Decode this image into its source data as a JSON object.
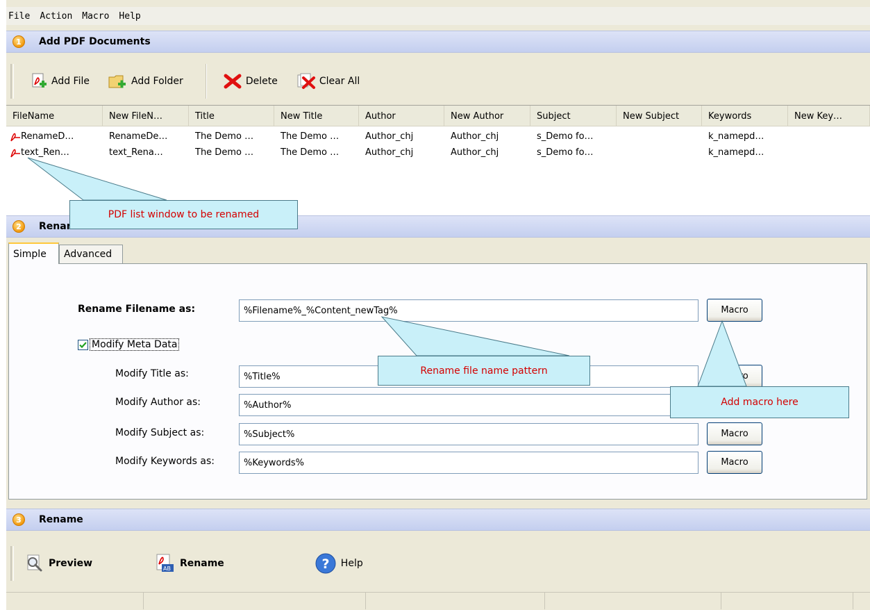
{
  "menu": [
    "File",
    "Action",
    "Macro",
    "Help"
  ],
  "sections": {
    "add": {
      "number": "1",
      "title": "Add PDF Documents"
    },
    "rename_method": {
      "number": "2",
      "title": "Rename Method"
    },
    "rename": {
      "number": "3",
      "title": "Rename"
    }
  },
  "toolbar": {
    "add_file": "Add File",
    "add_folder": "Add Folder",
    "delete": "Delete",
    "clear_all": "Clear All"
  },
  "list": {
    "columns": [
      "FileName",
      "New FileN…",
      "Title",
      "New Title",
      "Author",
      "New Author",
      "Subject",
      "New Subject",
      "Keywords",
      "New Key…"
    ],
    "rows": [
      [
        "RenameD…",
        "RenameDe…",
        "The Demo …",
        "The Demo …",
        "Author_chj",
        "Author_chj",
        "s_Demo fo…",
        "",
        "k_namepd…",
        ""
      ],
      [
        "text_Ren…",
        "text_Rena…",
        "The Demo …",
        "The Demo …",
        "Author_chj",
        "Author_chj",
        "s_Demo fo…",
        "",
        "k_namepd…",
        ""
      ]
    ]
  },
  "tabs": {
    "simple": "Simple",
    "advanced": "Advanced"
  },
  "form": {
    "filename_label": "Rename Filename as:",
    "filename_value": "%Filename%_%Content_newTag%",
    "modify_meta_label": "Modify Meta Data",
    "modify_meta_checked": true,
    "title_label": "Modify Title as:",
    "title_value": "%Title%",
    "author_label": "Modify Author as:",
    "author_value": "%Author%",
    "subject_label": "Modify Subject as:",
    "subject_value": "%Subject%",
    "keywords_label": "Modify Keywords as:",
    "keywords_value": "%Keywords%",
    "macro_label": "Macro"
  },
  "actions": {
    "preview": "Preview",
    "rename": "Rename",
    "help": "Help"
  },
  "callouts": {
    "pdf_list": "PDF list window to be renamed",
    "pattern": "Rename file name pattern",
    "macro": "Add macro here"
  },
  "colors": {
    "callout_bg": "#c9f0f9",
    "callout_text": "#d40000",
    "header_bg": "#c4cfef",
    "badge": "#f29a0f"
  }
}
